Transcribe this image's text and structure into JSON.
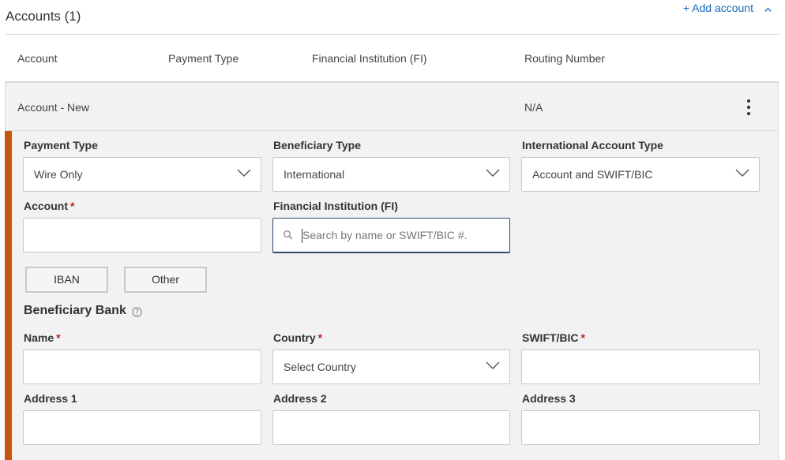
{
  "section": {
    "title": "Accounts (1)",
    "add_account_label": "+ Add account"
  },
  "columns": [
    "Account",
    "Payment Type",
    "Financial Institution (FI)",
    "Routing Number"
  ],
  "account_row": {
    "account": "Account - New",
    "routing_number": "N/A"
  },
  "form": {
    "payment_type": {
      "label": "Payment Type",
      "value": "Wire Only"
    },
    "beneficiary_type": {
      "label": "Beneficiary Type",
      "value": "International"
    },
    "intl_account_type": {
      "label": "International Account Type",
      "value": "Account and SWIFT/BIC"
    },
    "account": {
      "label": "Account",
      "required_mark": "*",
      "value": ""
    },
    "fi": {
      "label": "Financial Institution (FI)",
      "placeholder": "Search by name or SWIFT/BIC #."
    },
    "buttons": {
      "iban": "IBAN",
      "other": "Other"
    },
    "beneficiary_bank": {
      "heading": "Beneficiary Bank",
      "name": {
        "label": "Name",
        "required_mark": "*",
        "value": ""
      },
      "country": {
        "label": "Country",
        "required_mark": "*",
        "value": "Select Country"
      },
      "swift": {
        "label": "SWIFT/BIC",
        "required_mark": "*",
        "value": ""
      },
      "address1": {
        "label": "Address 1",
        "value": ""
      },
      "address2": {
        "label": "Address 2",
        "value": ""
      },
      "address3": {
        "label": "Address 3",
        "value": ""
      }
    }
  },
  "colors": {
    "accent_bar": "#c5570f",
    "link": "#1a66b8",
    "required": "#c11b1b",
    "panel_bg": "#f2f2f2"
  },
  "icons": {
    "add_account_toggle": "chevron-up-icon",
    "row_menu": "kebab-menu-icon",
    "dropdown": "chevron-down-icon",
    "search": "search-icon",
    "help": "help-circle-icon"
  }
}
